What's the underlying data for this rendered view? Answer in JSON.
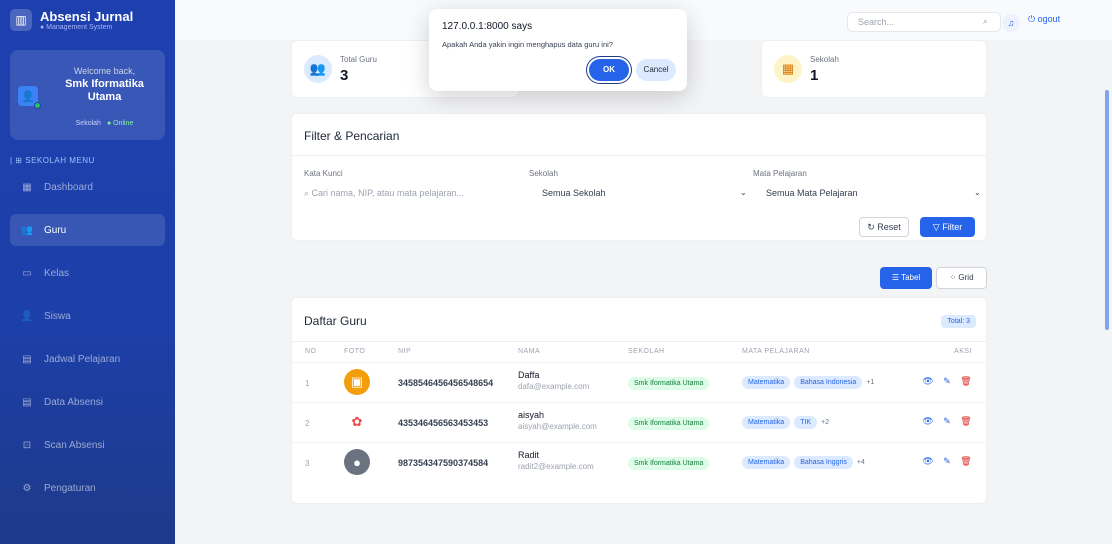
{
  "brand": {
    "title": "Absensi Jurnal",
    "subtitle": "● Management System"
  },
  "user": {
    "welcome": "Welcome back,",
    "name": "Smk Iformatika Utama",
    "role": "Sekolah",
    "status": "● Online"
  },
  "menu": {
    "title": "| ⊞ SEKOLAH MENU",
    "items": [
      {
        "label": "Dashboard",
        "icon": "dashboard-icon",
        "glyph": "▦",
        "active": false
      },
      {
        "label": "Guru",
        "icon": "users-icon",
        "glyph": "👥",
        "active": true
      },
      {
        "label": "Kelas",
        "icon": "class-icon",
        "glyph": "▭",
        "active": false
      },
      {
        "label": "Siswa",
        "icon": "student-icon",
        "glyph": "👤",
        "active": false
      },
      {
        "label": "Jadwal Pelajaran",
        "icon": "calendar-icon",
        "glyph": "▤",
        "active": false
      },
      {
        "label": "Data Absensi",
        "icon": "attendance-icon",
        "glyph": "▤",
        "active": false
      },
      {
        "label": "Scan Absensi",
        "icon": "qr-scan-icon",
        "glyph": "⊡",
        "active": false
      },
      {
        "label": "Pengaturan",
        "icon": "gear-icon",
        "glyph": "⚙",
        "active": false
      }
    ]
  },
  "topbar": {
    "search_placeholder": "Search...",
    "logout_label": "ogout"
  },
  "stats": [
    {
      "label": "Total Guru",
      "value": "3",
      "icon": "teacher-group-icon",
      "color": "#dbeafe"
    },
    {
      "label": "Sekolah",
      "value": "1",
      "icon": "building-icon",
      "color": "#fef3c7"
    }
  ],
  "filter": {
    "title": "Filter & Pencarian",
    "keyword_label": "Kata Kunci",
    "keyword_placeholder": "Cari nama, NIP, atau mata pelajaran...",
    "school_label": "Sekolah",
    "school_value": "Semua Sekolah",
    "subject_label": "Mata Pelajaran",
    "subject_value": "Semua Mata Pelajaran",
    "reset_label": "Reset",
    "filter_label": "Filter"
  },
  "view_toggle": {
    "table_label": "Tabel",
    "grid_label": "Grid"
  },
  "teachers": {
    "title": "Daftar Guru",
    "total": "Total: 3",
    "columns": [
      "NO",
      "FOTO",
      "NIP",
      "NAMA",
      "SEKOLAH",
      "MATA PELAJARAN",
      "AKSI"
    ],
    "rows": [
      {
        "no": "1",
        "nip": "3458546456456548654",
        "nama": "Daffa",
        "email": "dafa@example.com",
        "sekolah": "Smk Iformatika Utama",
        "mapel": [
          "Matematika",
          "Bahasa Indonesia"
        ],
        "more": "+1"
      },
      {
        "no": "2",
        "nip": "435346456563453453",
        "nama": "aisyah",
        "email": "aisyah@example.com",
        "sekolah": "Smk Iformatika Utama",
        "mapel": [
          "Matematika",
          "TIK"
        ],
        "more": "+2"
      },
      {
        "no": "3",
        "nip": "987354347590374584",
        "nama": "Radit",
        "email": "radit2@example.com",
        "sekolah": "Smk Iformatika Utama",
        "mapel": [
          "Matematika",
          "Bahasa Inggris"
        ],
        "more": "+4"
      }
    ]
  },
  "dialog": {
    "title": "127.0.0.1:8000 says",
    "message": "Apakah Anda yakin ingin menghapus data guru ini?",
    "ok_label": "OK",
    "cancel_label": "Cancel"
  },
  "colors": {
    "primary": "#2563eb",
    "sidebar": "#1e40af",
    "success": "#15803d"
  }
}
